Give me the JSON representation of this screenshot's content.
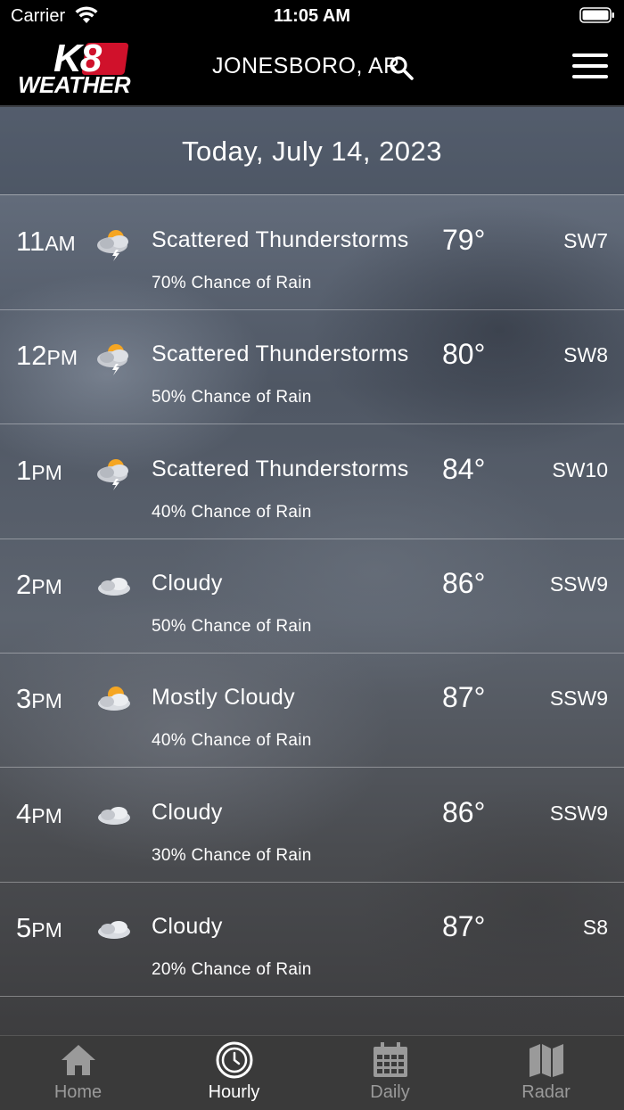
{
  "status_bar": {
    "carrier": "Carrier",
    "time": "11:05 AM"
  },
  "header": {
    "logo_top": "K8",
    "logo_bottom": "WEATHER",
    "location": "JONESBORO, AR"
  },
  "date_banner": "Today, July 14, 2023",
  "hours": [
    {
      "hour": "11",
      "ampm": "AM",
      "icon": "thunderstorm-icon",
      "condition": "Scattered Thunderstorms",
      "rain": "70% Chance of Rain",
      "temp": "79°",
      "wind": "SW7"
    },
    {
      "hour": "12",
      "ampm": "PM",
      "icon": "thunderstorm-icon",
      "condition": "Scattered Thunderstorms",
      "rain": "50% Chance of Rain",
      "temp": "80°",
      "wind": "SW8"
    },
    {
      "hour": "1",
      "ampm": "PM",
      "icon": "thunderstorm-icon",
      "condition": "Scattered Thunderstorms",
      "rain": "40% Chance of Rain",
      "temp": "84°",
      "wind": "SW10"
    },
    {
      "hour": "2",
      "ampm": "PM",
      "icon": "cloud-icon",
      "condition": "Cloudy",
      "rain": "50% Chance of Rain",
      "temp": "86°",
      "wind": "SSW9"
    },
    {
      "hour": "3",
      "ampm": "PM",
      "icon": "mostly-cloudy-icon",
      "condition": "Mostly Cloudy",
      "rain": "40% Chance of Rain",
      "temp": "87°",
      "wind": "SSW9"
    },
    {
      "hour": "4",
      "ampm": "PM",
      "icon": "cloud-icon",
      "condition": "Cloudy",
      "rain": "30% Chance of Rain",
      "temp": "86°",
      "wind": "SSW9"
    },
    {
      "hour": "5",
      "ampm": "PM",
      "icon": "cloud-icon",
      "condition": "Cloudy",
      "rain": "20% Chance of Rain",
      "temp": "87°",
      "wind": "S8"
    }
  ],
  "tabs": [
    {
      "label": "Home",
      "icon": "home-icon",
      "active": false
    },
    {
      "label": "Hourly",
      "icon": "clock-icon",
      "active": true
    },
    {
      "label": "Daily",
      "icon": "calendar-icon",
      "active": false
    },
    {
      "label": "Radar",
      "icon": "map-icon",
      "active": false
    }
  ],
  "colors": {
    "brand_red": "#d0112b",
    "tab_inactive": "#9a9a9a",
    "tabbar_bg": "#3a3a3a"
  }
}
